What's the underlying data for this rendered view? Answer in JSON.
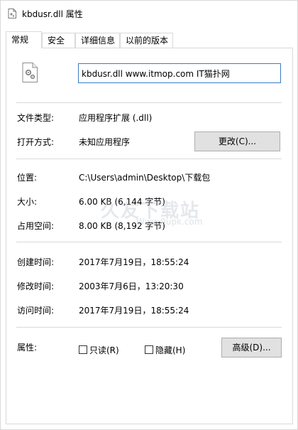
{
  "window": {
    "title": "kbdusr.dll 属性"
  },
  "tabs": [
    {
      "label": "常规"
    },
    {
      "label": "安全"
    },
    {
      "label": "详细信息"
    },
    {
      "label": "以前的版本"
    }
  ],
  "general": {
    "file_name": "kbdusr.dll www.itmop.com IT猫扑网",
    "file_type_label": "文件类型:",
    "file_type_value": "应用程序扩展 (.dll)",
    "open_with_label": "打开方式:",
    "open_with_value": "未知应用程序",
    "change_button": "更改(C)...",
    "location_label": "位置:",
    "location_value": "C:\\Users\\admin\\Desktop\\下载包",
    "size_label": "大小:",
    "size_value": "6.00 KB (6,144 字节)",
    "size_on_disk_label": "占用空间:",
    "size_on_disk_value": "8.00 KB (8,192 字节)",
    "created_label": "创建时间:",
    "created_value": "2017年7月19日，18:55:24",
    "modified_label": "修改时间:",
    "modified_value": "2003年7月6日，13:20:30",
    "accessed_label": "访问时间:",
    "accessed_value": "2017年7月19日，18:55:24",
    "attributes_label": "属性:",
    "readonly_label": "只读(R)",
    "readonly_checked": false,
    "hidden_label": "隐藏(H)",
    "hidden_checked": false,
    "advanced_button": "高级(D)..."
  },
  "watermark": {
    "text": "久友下载站",
    "url": "Www.9upk.com"
  },
  "colors": {
    "border": "#d9d9d9",
    "input_border": "#3b7bbf",
    "button_bg": "#e1e1e1",
    "button_border": "#adadad"
  }
}
